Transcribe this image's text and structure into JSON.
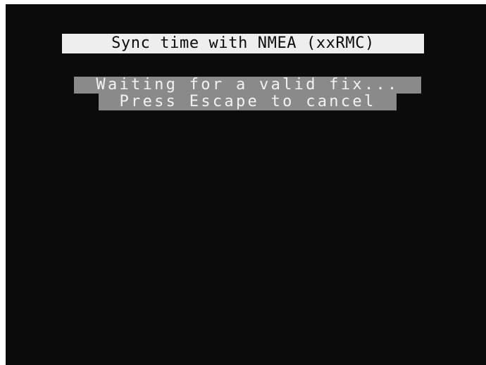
{
  "screen": {
    "title": "Sync time with NMEA (xxRMC)",
    "status_message": "Waiting for a valid fix...",
    "cancel_hint": "Press Escape to cancel",
    "colors": {
      "background": "#0b0b0b",
      "title_highlight": "#eeeeee",
      "message_highlight": "#8a8a8a",
      "text_light": "#f2f2f2",
      "text_dark": "#0b0b0b"
    }
  }
}
